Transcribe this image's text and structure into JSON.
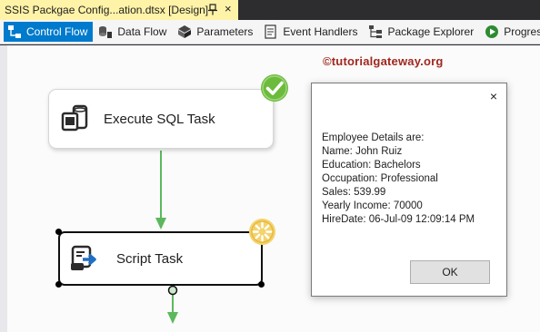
{
  "document_tab": {
    "title": "SSIS Packgae Config...ation.dtsx [Design]",
    "pin_icon": "pin-icon",
    "close_label": "×"
  },
  "designer_tabs": [
    {
      "label": "Control Flow",
      "icon": "control-flow-icon",
      "active": true
    },
    {
      "label": "Data Flow",
      "icon": "data-flow-icon",
      "active": false
    },
    {
      "label": "Parameters",
      "icon": "parameters-icon",
      "active": false
    },
    {
      "label": "Event Handlers",
      "icon": "event-handlers-icon",
      "active": false
    },
    {
      "label": "Package Explorer",
      "icon": "package-explorer-icon",
      "active": false
    },
    {
      "label": "Progress",
      "icon": "progress-icon",
      "active": false
    }
  ],
  "watermark": "©tutorialgateway.org",
  "tasks": {
    "sql": {
      "label": "Execute SQL Task",
      "status": "success"
    },
    "script": {
      "label": "Script Task",
      "status": "running"
    }
  },
  "message_box": {
    "close_label": "×",
    "lines": [
      "Employee Details are:",
      "Name: John Ruiz",
      "Education: Bachelors",
      "Occupation: Professional",
      "Sales: 539.99",
      "Yearly Income: 70000",
      "HireDate: 06-Jul-09 12:09:14 PM"
    ],
    "ok_label": "OK"
  },
  "colors": {
    "tab_active": "#007acc",
    "doc_tab": "#fff3a8",
    "success": "#6cbb3c",
    "connector": "#5cb85c",
    "watermark": "#a0281e"
  }
}
